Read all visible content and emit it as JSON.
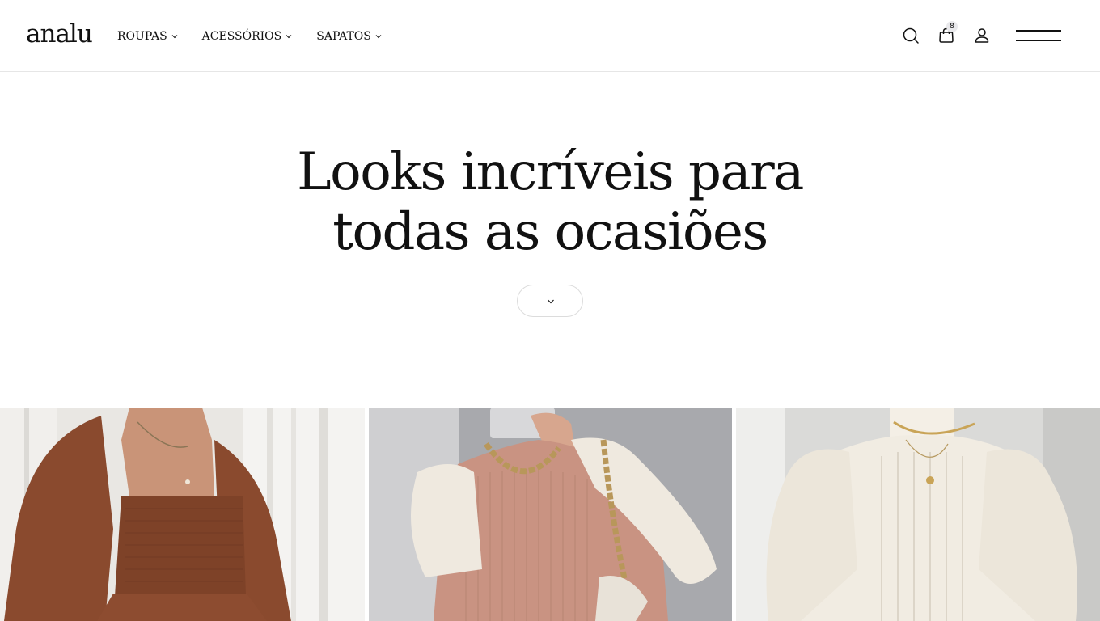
{
  "header": {
    "logo": "analu",
    "nav": [
      {
        "label": "ROUPAS"
      },
      {
        "label": "ACESSÓRIOS"
      },
      {
        "label": "SAPATOS"
      }
    ],
    "cart_count": "8",
    "icons": [
      "search-icon",
      "bag-icon",
      "user-icon",
      "menu-icon"
    ]
  },
  "hero": {
    "title_line1": "Looks incríveis para",
    "title_line2": "todas as ocasiões"
  },
  "gallery": {
    "items": [
      {
        "description": "brown smocked dress"
      },
      {
        "description": "pink and cream knit sweater"
      },
      {
        "description": "white ribbed knit sweater"
      }
    ]
  },
  "colors": {
    "text": "#111111",
    "border": "#e6e6e6",
    "dress_brown": "#8a4a2e",
    "sweater_pink": "#c99382",
    "sweater_cream": "#efe9df"
  }
}
